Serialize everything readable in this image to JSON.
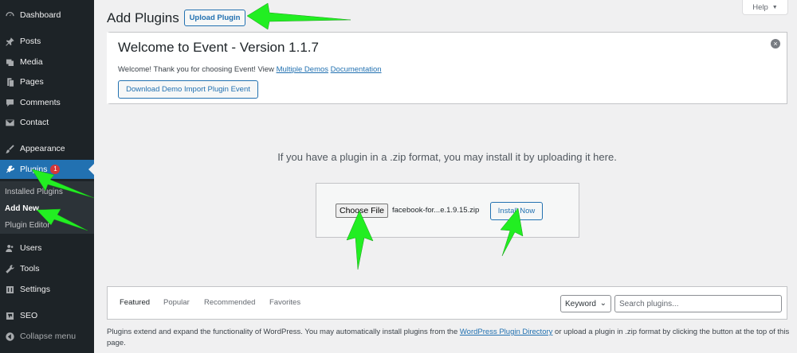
{
  "colors": {
    "sidebar_bg": "#1d2327",
    "accent": "#2271b1",
    "badge": "#d63638",
    "annotation_arrow": "#22ee22"
  },
  "sidebar": {
    "items": [
      {
        "label": "Dashboard",
        "icon": "dashboard-icon"
      },
      {
        "label": "Posts",
        "icon": "pin-icon"
      },
      {
        "label": "Media",
        "icon": "media-icon"
      },
      {
        "label": "Pages",
        "icon": "pages-icon"
      },
      {
        "label": "Comments",
        "icon": "comment-icon"
      },
      {
        "label": "Contact",
        "icon": "mail-icon"
      },
      {
        "label": "Appearance",
        "icon": "brush-icon"
      },
      {
        "label": "Plugins",
        "icon": "plugin-icon",
        "badge": "1"
      },
      {
        "label": "Users",
        "icon": "users-icon"
      },
      {
        "label": "Tools",
        "icon": "wrench-icon"
      },
      {
        "label": "Settings",
        "icon": "settings-icon"
      },
      {
        "label": "SEO",
        "icon": "seo-icon"
      },
      {
        "label": "Collapse menu",
        "icon": "collapse-icon"
      }
    ],
    "submenu": [
      {
        "label": "Installed Plugins"
      },
      {
        "label": "Add New"
      },
      {
        "label": "Plugin Editor"
      }
    ]
  },
  "header": {
    "title": "Add Plugins",
    "upload_button": "Upload Plugin",
    "help_label": "Help"
  },
  "notice": {
    "title": "Welcome to Event - Version 1.1.7",
    "text_prefix": "Welcome! Thank you for choosing Event! View",
    "link_demos": "Multiple Demos",
    "link_docs": "Documentation",
    "button": "Download Demo Import Plugin Event",
    "dismiss": "×"
  },
  "upload": {
    "hint": "If you have a plugin in a .zip format, you may install it by uploading it here.",
    "choose_file": "Choose File",
    "file_name": "facebook-for...e.1.9.15.zip",
    "install_button": "Install Now"
  },
  "filter": {
    "tabs": [
      "Featured",
      "Popular",
      "Recommended",
      "Favorites"
    ],
    "select_value": "Keyword",
    "search_placeholder": "Search plugins..."
  },
  "description": {
    "text_before": "Plugins extend and expand the functionality of WordPress. You may automatically install plugins from the",
    "link": "WordPress Plugin Directory",
    "text_after": "or upload a plugin in .zip format by clicking the button at the top of this page."
  }
}
